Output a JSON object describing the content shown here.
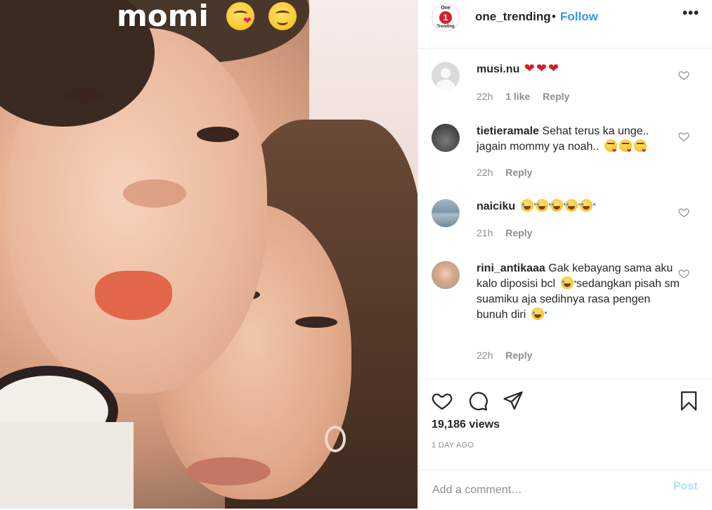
{
  "media": {
    "overlay_text": "momi"
  },
  "header": {
    "logo_top": "One",
    "logo_mid": "1",
    "logo_bottom": "Trending",
    "username": "one_trending",
    "separator": "•",
    "follow_label": "Follow",
    "more_label": "•••"
  },
  "comments": [
    {
      "username": "musi.nu",
      "text": "",
      "time": "22h",
      "likes": "1 like",
      "reply": "Reply",
      "avatar": "default-avatar"
    },
    {
      "username": "tietieramale",
      "text": "Sehat terus ka unge.. jagain mommy ya noah..",
      "time": "22h",
      "likes": "",
      "reply": "Reply",
      "avatar": "night-photo-avatar"
    },
    {
      "username": "naiciku",
      "text": "",
      "time": "21h",
      "likes": "",
      "reply": "Reply",
      "avatar": "sea-photo-avatar"
    },
    {
      "username": "rini_antikaaa",
      "text": "Gak kebayang sama aku kalo diposisi bcl",
      "text2": "sedangkan pisah sm suamiku aja sedihnya rasa pengen bunuh diri",
      "time": "22h",
      "likes": "",
      "reply": "Reply",
      "avatar": "woman-photo-avatar"
    }
  ],
  "actions": {
    "views": "19,186 views",
    "date": "1 DAY AGO"
  },
  "add_comment": {
    "placeholder": "Add a comment…",
    "post_label": "Post"
  },
  "colors": {
    "link_blue": "#3897f0",
    "post_disabled": "#b2dffc",
    "muted": "#8e8e8e",
    "text": "#262626"
  }
}
